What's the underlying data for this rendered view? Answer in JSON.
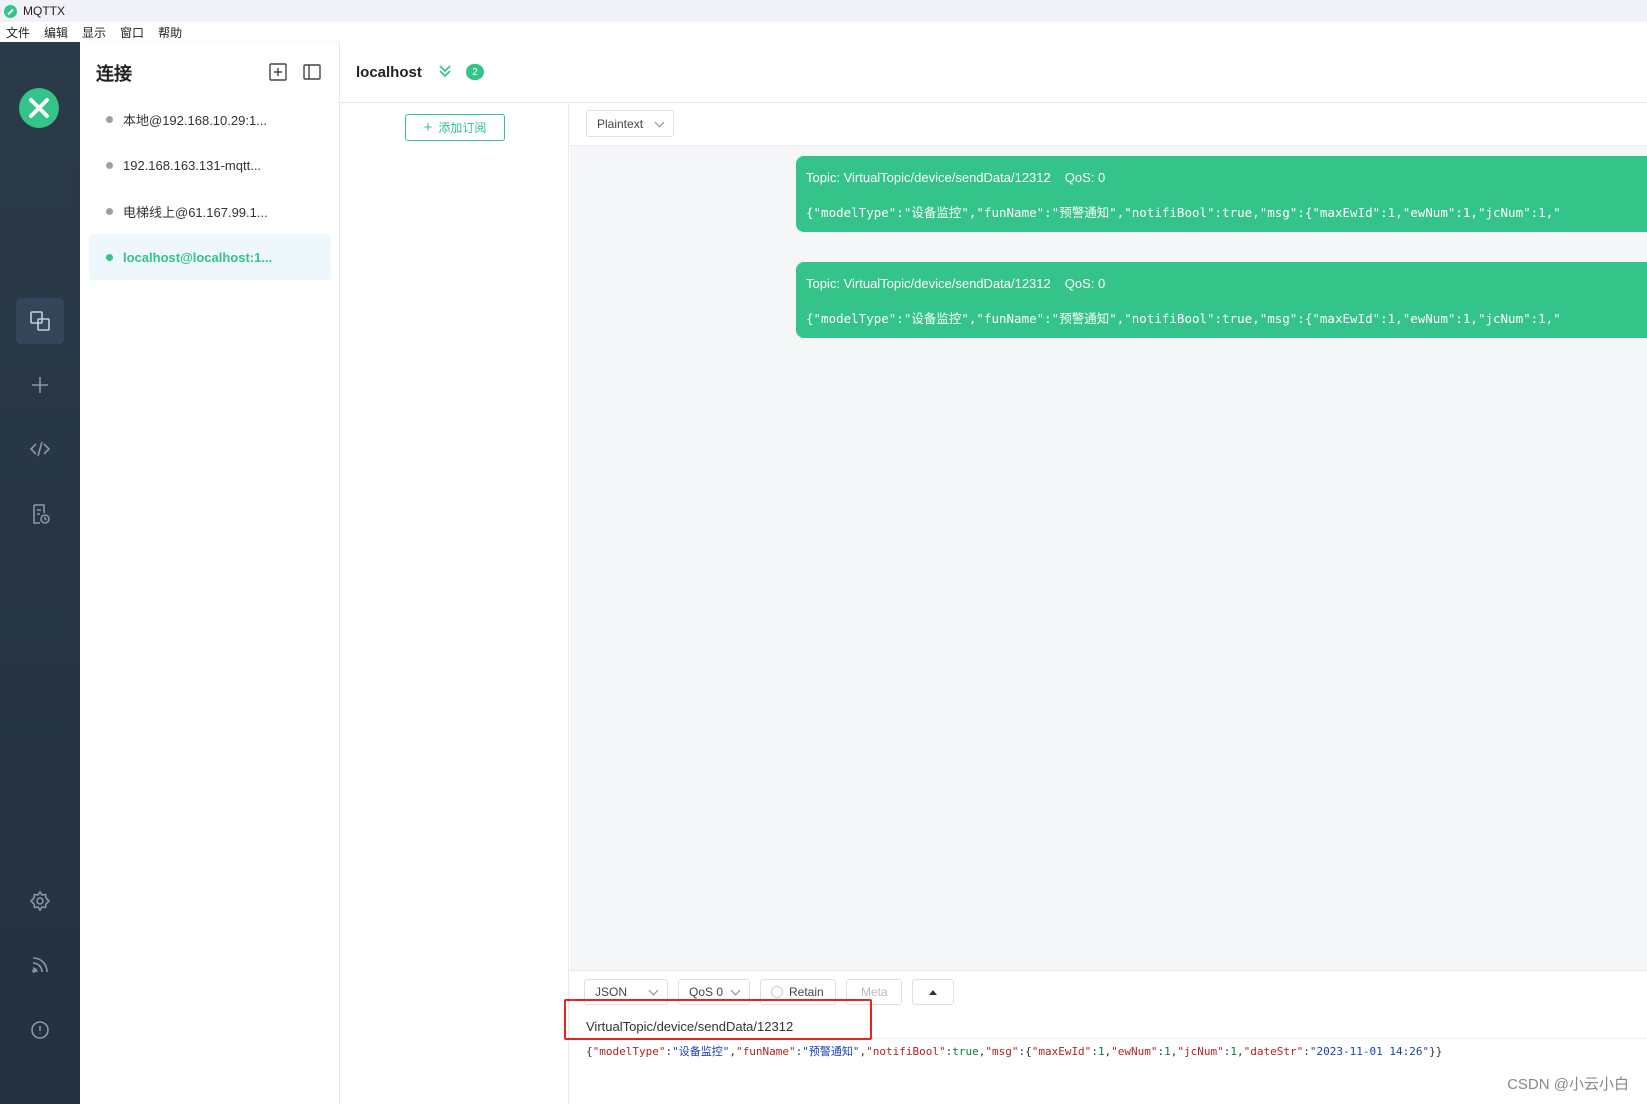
{
  "window": {
    "title": "MQTTX"
  },
  "menu": {
    "items": [
      "文件",
      "编辑",
      "显示",
      "窗口",
      "帮助"
    ]
  },
  "connections": {
    "title": "连接",
    "items": [
      {
        "label": "本地@192.168.10.29:1..."
      },
      {
        "label": "192.168.163.131-mqtt..."
      },
      {
        "label": "电梯线上@61.167.99.1..."
      },
      {
        "label": "localhost@localhost:1..."
      }
    ]
  },
  "main": {
    "host": "localhost",
    "badge_count": "2"
  },
  "subscriptions": {
    "add_label": "添加订阅"
  },
  "messages": {
    "format": "Plaintext",
    "items": [
      {
        "topic": "Topic: VirtualTopic/device/sendData/12312",
        "qos": "QoS: 0",
        "payload": "{\"modelType\":\"设备监控\",\"funName\":\"预警通知\",\"notifiBool\":true,\"msg\":{\"maxEwId\":1,\"ewNum\":1,\"jcNum\":1,\""
      },
      {
        "topic": "Topic: VirtualTopic/device/sendData/12312",
        "qos": "QoS: 0",
        "payload": "{\"modelType\":\"设备监控\",\"funName\":\"预警通知\",\"notifiBool\":true,\"msg\":{\"maxEwId\":1,\"ewNum\":1,\"jcNum\":1,\""
      }
    ]
  },
  "compose": {
    "format": "JSON",
    "qos": "QoS 0",
    "retain": "Retain",
    "meta": "Meta",
    "topic": "VirtualTopic/device/sendData/12312",
    "payload_tokens": [
      [
        "p",
        "{"
      ],
      [
        "k",
        "\"modelType\""
      ],
      [
        "p",
        ":"
      ],
      [
        "s",
        "\"设备监控\""
      ],
      [
        "p",
        ","
      ],
      [
        "k",
        "\"funName\""
      ],
      [
        "p",
        ":"
      ],
      [
        "s",
        "\"预警通知\""
      ],
      [
        "p",
        ","
      ],
      [
        "k",
        "\"notifiBool\""
      ],
      [
        "p",
        ":"
      ],
      [
        "n",
        "true"
      ],
      [
        "p",
        ","
      ],
      [
        "k",
        "\"msg\""
      ],
      [
        "p",
        ":{"
      ],
      [
        "k",
        "\"maxEwId\""
      ],
      [
        "p",
        ":"
      ],
      [
        "n",
        "1"
      ],
      [
        "p",
        ","
      ],
      [
        "k",
        "\"ewNum\""
      ],
      [
        "p",
        ":"
      ],
      [
        "n",
        "1"
      ],
      [
        "p",
        ","
      ],
      [
        "k",
        "\"jcNum\""
      ],
      [
        "p",
        ":"
      ],
      [
        "n",
        "1"
      ],
      [
        "p",
        ","
      ],
      [
        "k",
        "\"dateStr\""
      ],
      [
        "p",
        ":"
      ],
      [
        "s",
        "\"2023-11-01 14:26\""
      ],
      [
        "p",
        "}}"
      ]
    ]
  },
  "watermark": "CSDN @小云小白",
  "colors": {
    "accent": "#34c388",
    "sidebar": "#2b3a48",
    "highlight": "#e0261f"
  }
}
